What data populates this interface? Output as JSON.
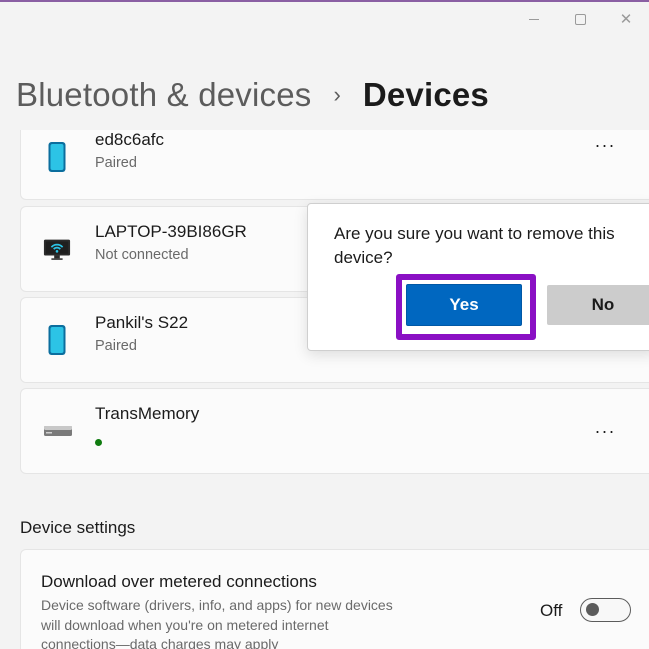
{
  "window": {
    "controls": {
      "minimize_icon": "minimize-icon",
      "maximize_icon": "maximize-icon",
      "close_icon": "close-icon",
      "close_glyph": "✕"
    }
  },
  "breadcrumb": {
    "parent": "Bluetooth & devices",
    "separator": "›",
    "current": "Devices"
  },
  "devices": [
    {
      "name": "ed8c6afc",
      "status": "Paired",
      "icon": "phone-icon"
    },
    {
      "name": "LAPTOP-39BI86GR",
      "status": "Not connected",
      "icon": "wireless-display-icon"
    },
    {
      "name": "Pankil's S22",
      "status": "Paired",
      "icon": "phone-icon"
    },
    {
      "name": "TransMemory",
      "status": "",
      "icon": "usb-drive-icon",
      "status_color": "#0f7b0f"
    }
  ],
  "more_label": "···",
  "device_settings": {
    "section_title": "Device settings",
    "metered": {
      "title": "Download over metered connections",
      "description": "Device software (drivers, info, and apps) for new devices will download when you're on metered internet connections—data charges may apply",
      "toggle_label": "Off",
      "toggle_on": false
    }
  },
  "dialog": {
    "message": "Are you sure you want to remove this device?",
    "yes_label": "Yes",
    "no_label": "No",
    "highlight_color": "#8a10c4",
    "accent": "#0067c0"
  }
}
